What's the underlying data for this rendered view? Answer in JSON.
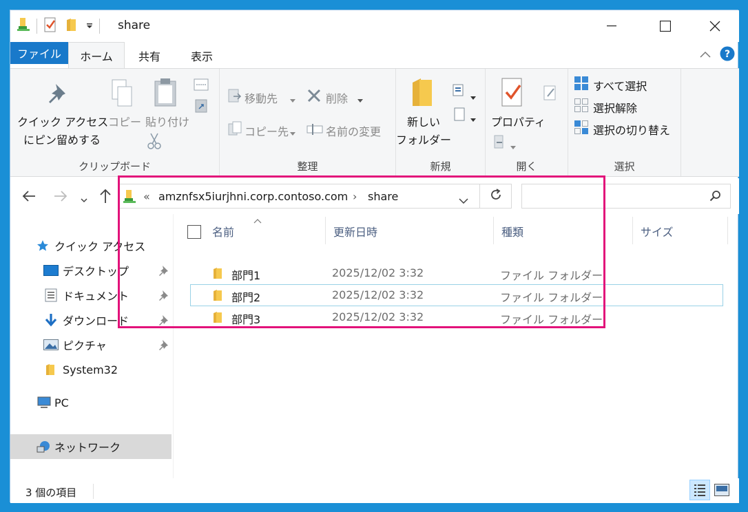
{
  "window": {
    "title": "share"
  },
  "ribbon_tabs": [
    {
      "label": "ファイル"
    },
    {
      "label": "ホーム"
    },
    {
      "label": "共有"
    },
    {
      "label": "表示"
    }
  ],
  "ribbon": {
    "clipboard": {
      "label": "クリップボード",
      "pin_line1": "クイック アクセス",
      "pin_line2": "にピン留めする",
      "copy": "コピー",
      "paste": "貼り付け"
    },
    "organize": {
      "label": "整理",
      "move_to": "移動先",
      "delete": "削除",
      "copy_to": "コピー先",
      "rename": "名前の変更"
    },
    "new": {
      "label": "新規",
      "new_folder_line1": "新しい",
      "new_folder_line2": "フォルダー"
    },
    "open": {
      "label": "開く",
      "properties": "プロパティ"
    },
    "select": {
      "label": "選択",
      "select_all": "すべて選択",
      "select_none": "選択解除",
      "invert": "選択の切り替え"
    }
  },
  "address": {
    "overflow": "«",
    "segment_host": "amznfsx5iurjhni.corp.contoso.com",
    "segment_share": "share",
    "separator": "›"
  },
  "nav_pane": {
    "quick_access": "クイック アクセス",
    "items": [
      {
        "label": "デスクトップ"
      },
      {
        "label": "ドキュメント"
      },
      {
        "label": "ダウンロード"
      },
      {
        "label": "ピクチャ"
      },
      {
        "label": "System32"
      }
    ],
    "pc": "PC",
    "network": "ネットワーク"
  },
  "columns": {
    "name": "名前",
    "modified": "更新日時",
    "type": "種類",
    "size": "サイズ"
  },
  "files": [
    {
      "name": "部門1",
      "modified": "2025/12/02 3:32",
      "type": "ファイル フォルダー"
    },
    {
      "name": "部門2",
      "modified": "2025/12/02 3:32",
      "type": "ファイル フォルダー"
    },
    {
      "name": "部門3",
      "modified": "2025/12/02 3:32",
      "type": "ファイル フォルダー"
    }
  ],
  "status": {
    "item_count": "3 個の項目"
  },
  "colors": {
    "accent": "#1979ca",
    "highlight_box": "#e2127a",
    "folder": "#f6c94e",
    "nav_selected": "#d9d9d9"
  }
}
